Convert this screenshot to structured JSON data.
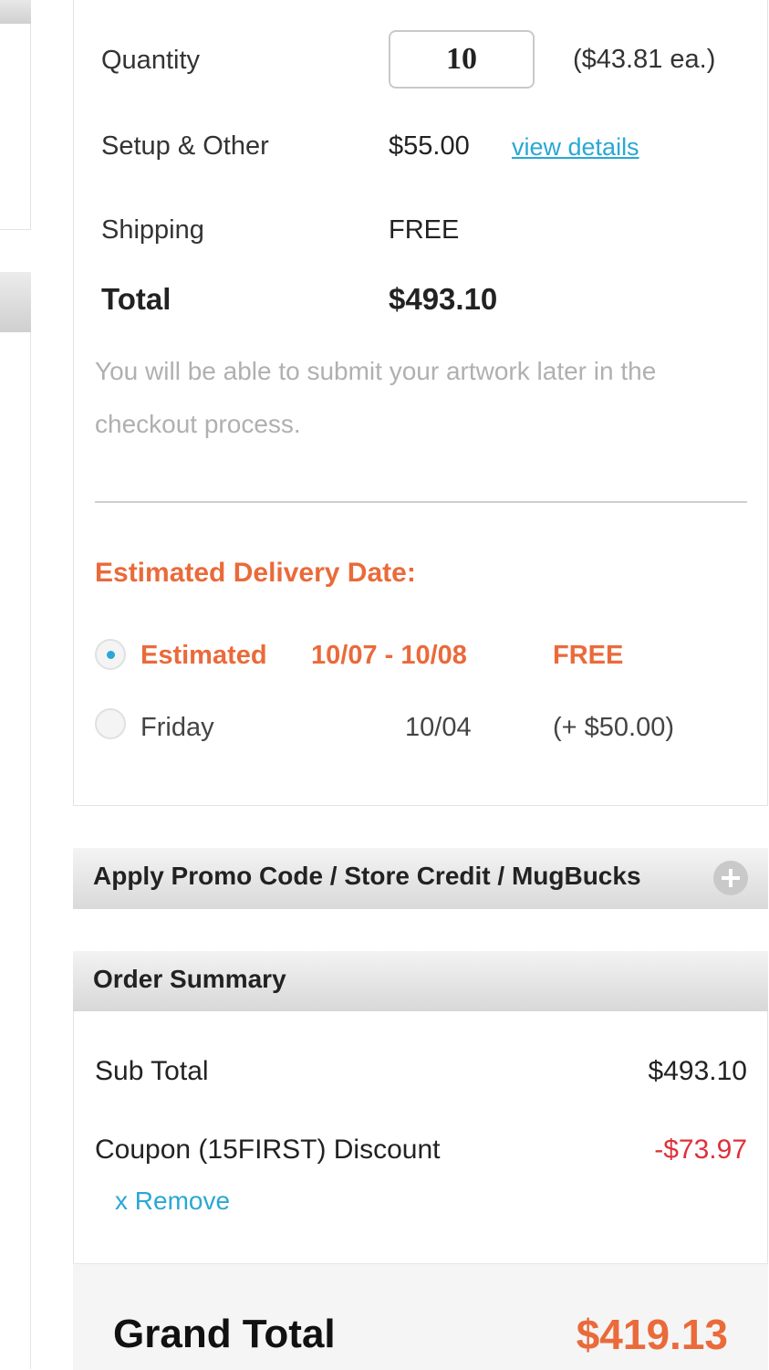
{
  "pricing": {
    "quantity_label": "Quantity",
    "quantity_value": "10",
    "each_price": "($43.81 ea.)",
    "setup_label": "Setup & Other",
    "setup_value": "$55.00",
    "view_details": "view details",
    "shipping_label": "Shipping",
    "shipping_value": "FREE",
    "total_label": "Total",
    "total_value": "$493.10",
    "artwork_note": "You will be able to submit your artwork later in the checkout process."
  },
  "delivery": {
    "heading": "Estimated Delivery Date:",
    "options": [
      {
        "label": "Estimated",
        "date": "10/07 - 10/08",
        "price": "FREE",
        "selected": true
      },
      {
        "label": "Friday",
        "date": "10/04",
        "price": "(+ $50.00)",
        "selected": false
      }
    ]
  },
  "promo": {
    "label": "Apply Promo Code / Store Credit / MugBucks",
    "icon": "plus-circle-icon"
  },
  "summary": {
    "title": "Order Summary",
    "subtotal_label": "Sub Total",
    "subtotal_value": "$493.10",
    "coupon_label": "Coupon (15FIRST) Discount",
    "coupon_value": "-$73.97",
    "remove_label": "x Remove",
    "grand_total_label": "Grand Total",
    "grand_total_value": "$419.13"
  },
  "colors": {
    "accent_orange": "#ea6a3a",
    "link_blue": "#2aa7d5",
    "discount_red": "#e0303a",
    "muted_gray": "#b0b0b0"
  }
}
